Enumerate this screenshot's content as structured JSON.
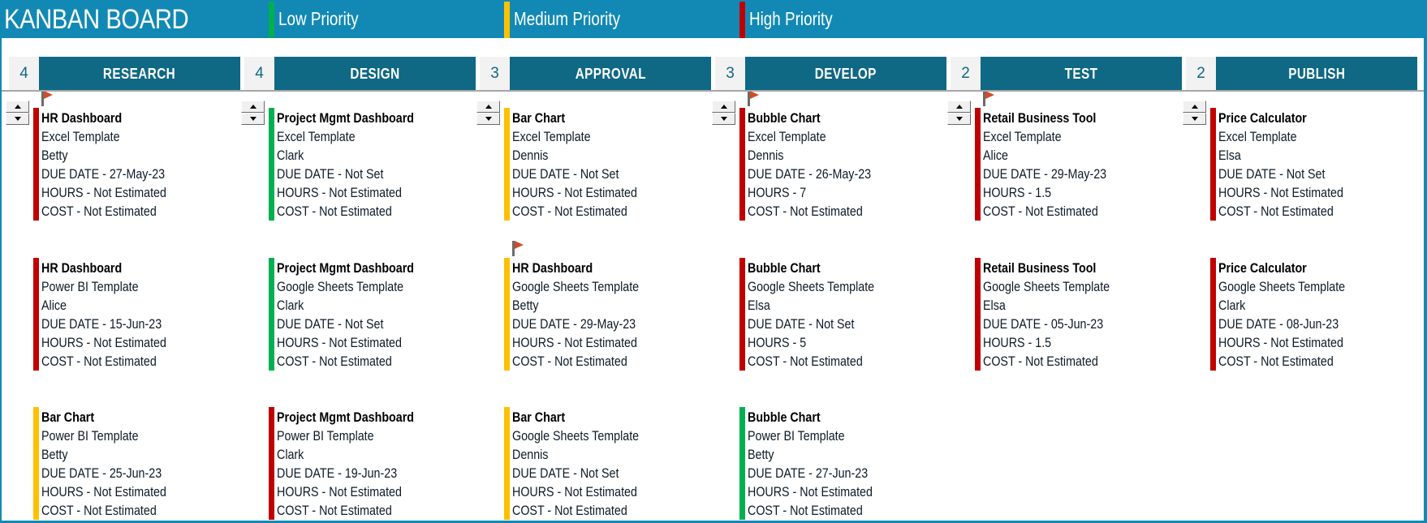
{
  "board": {
    "title": "KANBAN BOARD"
  },
  "legend": [
    {
      "label": "Low Priority",
      "priority": "low",
      "color": "#00b050"
    },
    {
      "label": "Medium Priority",
      "priority": "medium",
      "color": "#ffc000"
    },
    {
      "label": "High Priority",
      "priority": "high",
      "color": "#c00000"
    }
  ],
  "colors": {
    "header_bg": "#1289b4",
    "column_title_bg": "#0f6884",
    "count_bg": "#f2f2f2",
    "flag": "#d24a2a"
  },
  "columns": [
    {
      "title": "RESEARCH",
      "count": "4",
      "cards": [
        {
          "title": "HR Dashboard",
          "type": "Excel Template",
          "owner": "Betty",
          "due": "DUE DATE - 27-May-23",
          "hours": "HOURS - Not Estimated",
          "cost": "COST - Not Estimated",
          "priority": "high",
          "flagged": true
        },
        {
          "title": "HR Dashboard",
          "type": "Power BI Template",
          "owner": "Alice",
          "due": "DUE DATE - 15-Jun-23",
          "hours": "HOURS - Not Estimated",
          "cost": "COST - Not Estimated",
          "priority": "high",
          "flagged": false
        },
        {
          "title": "Bar Chart",
          "type": "Power BI Template",
          "owner": "Betty",
          "due": "DUE DATE - 25-Jun-23",
          "hours": "HOURS - Not Estimated",
          "cost": "COST - Not Estimated",
          "priority": "medium",
          "flagged": false
        }
      ]
    },
    {
      "title": "DESIGN",
      "count": "4",
      "cards": [
        {
          "title": "Project Mgmt Dashboard",
          "type": "Excel Template",
          "owner": "Clark",
          "due": "DUE DATE - Not Set",
          "hours": "HOURS - Not Estimated",
          "cost": "COST - Not Estimated",
          "priority": "low",
          "flagged": false
        },
        {
          "title": "Project Mgmt Dashboard",
          "type": "Google Sheets Template",
          "owner": "Clark",
          "due": "DUE DATE - Not Set",
          "hours": "HOURS - Not Estimated",
          "cost": "COST - Not Estimated",
          "priority": "low",
          "flagged": false
        },
        {
          "title": "Project Mgmt Dashboard",
          "type": "Power BI Template",
          "owner": "Clark",
          "due": "DUE DATE - 19-Jun-23",
          "hours": "HOURS - Not Estimated",
          "cost": "COST - Not Estimated",
          "priority": "high",
          "flagged": false
        }
      ]
    },
    {
      "title": "APPROVAL",
      "count": "3",
      "cards": [
        {
          "title": "Bar Chart",
          "type": "Excel Template",
          "owner": "Dennis",
          "due": "DUE DATE - Not Set",
          "hours": "HOURS - Not Estimated",
          "cost": "COST - Not Estimated",
          "priority": "medium",
          "flagged": false
        },
        {
          "title": "HR Dashboard",
          "type": "Google Sheets Template",
          "owner": "Betty",
          "due": "DUE DATE - 29-May-23",
          "hours": "HOURS - Not Estimated",
          "cost": "COST - Not Estimated",
          "priority": "medium",
          "flagged": true
        },
        {
          "title": "Bar Chart",
          "type": "Google Sheets Template",
          "owner": "Dennis",
          "due": "DUE DATE - Not Set",
          "hours": "HOURS - Not Estimated",
          "cost": "COST - Not Estimated",
          "priority": "medium",
          "flagged": false
        }
      ]
    },
    {
      "title": "DEVELOP",
      "count": "3",
      "cards": [
        {
          "title": "Bubble Chart",
          "type": "Excel Template",
          "owner": "Dennis",
          "due": "DUE DATE - 26-May-23",
          "hours": "HOURS - 7",
          "cost": "COST - Not Estimated",
          "priority": "high",
          "flagged": true
        },
        {
          "title": "Bubble Chart",
          "type": "Google Sheets Template",
          "owner": "Elsa",
          "due": "DUE DATE - Not Set",
          "hours": "HOURS - 5",
          "cost": "COST - Not Estimated",
          "priority": "high",
          "flagged": false
        },
        {
          "title": "Bubble Chart",
          "type": "Power BI Template",
          "owner": "Betty",
          "due": "DUE DATE - 27-Jun-23",
          "hours": "HOURS - Not Estimated",
          "cost": "COST - Not Estimated",
          "priority": "low",
          "flagged": false
        }
      ]
    },
    {
      "title": "TEST",
      "count": "2",
      "cards": [
        {
          "title": "Retail Business Tool",
          "type": "Excel Template",
          "owner": "Alice",
          "due": "DUE DATE - 29-May-23",
          "hours": "HOURS - 1.5",
          "cost": "COST - Not Estimated",
          "priority": "high",
          "flagged": true
        },
        {
          "title": "Retail Business Tool",
          "type": "Google Sheets Template",
          "owner": "Elsa",
          "due": "DUE DATE - 05-Jun-23",
          "hours": "HOURS - 1.5",
          "cost": "COST - Not Estimated",
          "priority": "high",
          "flagged": false
        }
      ]
    },
    {
      "title": "PUBLISH",
      "count": "2",
      "cards": [
        {
          "title": "Price Calculator",
          "type": "Excel Template",
          "owner": "Elsa",
          "due": "DUE DATE - Not Set",
          "hours": "HOURS - Not Estimated",
          "cost": "COST - Not Estimated",
          "priority": "high",
          "flagged": false
        },
        {
          "title": "Price Calculator",
          "type": "Google Sheets Template",
          "owner": "Clark",
          "due": "DUE DATE - 08-Jun-23",
          "hours": "HOURS - Not Estimated",
          "cost": "COST - Not Estimated",
          "priority": "high",
          "flagged": false
        }
      ]
    }
  ]
}
